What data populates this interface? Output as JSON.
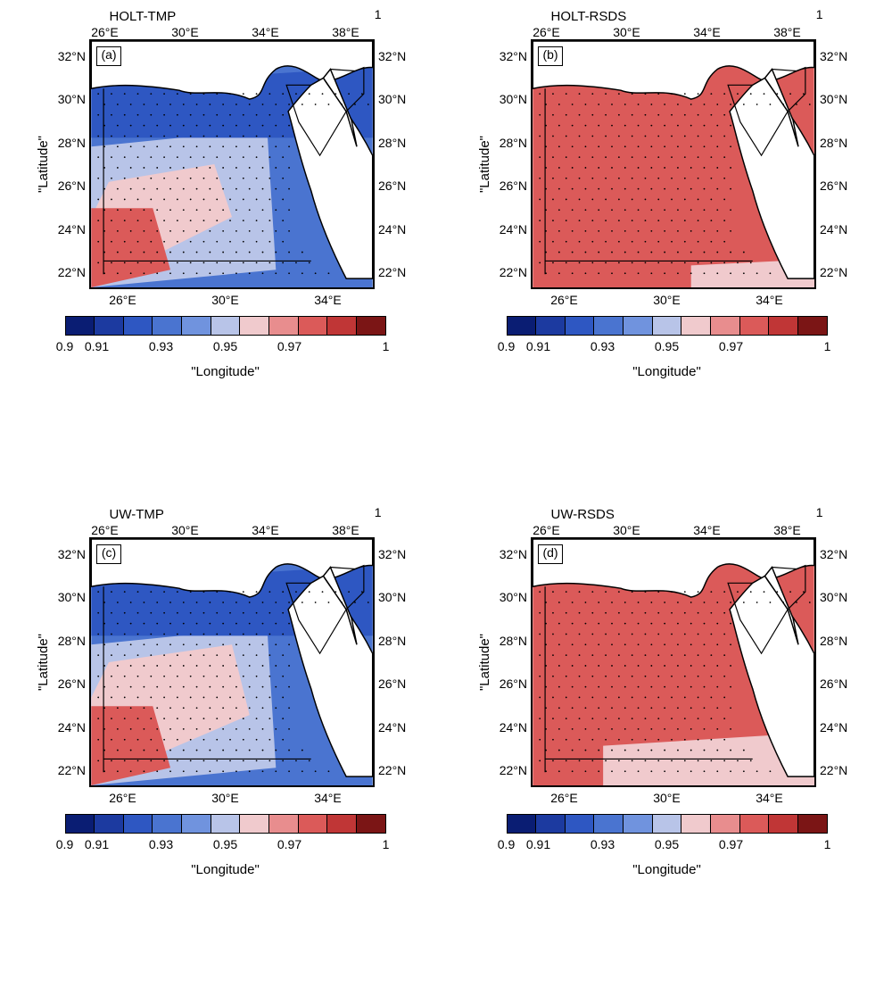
{
  "chart_data": [
    {
      "id": "a",
      "title": "HOLT-TMP",
      "panel_letter": "(a)",
      "type": "heatmap",
      "xlabel": "\"Longitude\"",
      "ylabel": "\"Latitude\"",
      "top_right": "1",
      "lon_ticks": [
        "26°E",
        "30°E",
        "34°E",
        "38°E"
      ],
      "lon_ticks_bottom": [
        "26°E",
        "30°E",
        "34°E"
      ],
      "lat_ticks": [
        "32°N",
        "30°N",
        "28°N",
        "26°N",
        "24°N",
        "22°N"
      ],
      "colorbar": {
        "levels": [
          0.9,
          0.91,
          0.92,
          0.93,
          0.94,
          0.95,
          0.96,
          0.97,
          0.98,
          0.99,
          1
        ],
        "colors": [
          "#0a1d73",
          "#1c3aa0",
          "#2e57c2",
          "#4a74d0",
          "#7093de",
          "#b8c4e8",
          "#f0cacd",
          "#e88d8e",
          "#db5a59",
          "#c03636",
          "#7b1515"
        ],
        "tick_labels": [
          "0.9",
          "0.91",
          "0.93",
          "0.95",
          "0.97",
          "1"
        ],
        "tick_pos": [
          0,
          0.1,
          0.3,
          0.5,
          0.7,
          1.0
        ]
      },
      "description": "Correlation map over Egypt/NE Africa. North coast band ~0.91–0.93 (blue). Central Nile/Sinai ~0.94 (light lavender). SW desert ~0.95–0.97 (pink/red). Far SW corner >0.97 (red). Stippling over most land."
    },
    {
      "id": "b",
      "title": "HOLT-RSDS",
      "panel_letter": "(b)",
      "type": "heatmap",
      "xlabel": "\"Longitude\"",
      "ylabel": "\"Latitude\"",
      "top_right": "1",
      "lon_ticks": [
        "26°E",
        "30°E",
        "34°E",
        "38°E"
      ],
      "lon_ticks_bottom": [
        "26°E",
        "30°E",
        "34°E"
      ],
      "lat_ticks": [
        "32°N",
        "30°N",
        "28°N",
        "26°N",
        "24°N",
        "22°N"
      ],
      "colorbar": {
        "levels": [
          0.9,
          0.91,
          0.92,
          0.93,
          0.94,
          0.95,
          0.96,
          0.97,
          0.98,
          0.99,
          1
        ],
        "colors": [
          "#0a1d73",
          "#1c3aa0",
          "#2e57c2",
          "#4a74d0",
          "#7093de",
          "#b8c4e8",
          "#f0cacd",
          "#e88d8e",
          "#db5a59",
          "#c03636",
          "#7b1515"
        ],
        "tick_labels": [
          "0.9",
          "0.91",
          "0.93",
          "0.95",
          "0.97",
          "1"
        ],
        "tick_pos": [
          0,
          0.1,
          0.3,
          0.5,
          0.7,
          1.0
        ]
      },
      "description": "Nearly uniform ~0.97–0.98 (red) over whole domain. Slight pink ~0.95–0.96 along far south strip. Stippled land."
    },
    {
      "id": "c",
      "title": "UW-TMP",
      "panel_letter": "(c)",
      "type": "heatmap",
      "xlabel": "\"Longitude\"",
      "ylabel": "\"Latitude\"",
      "top_right": "1",
      "lon_ticks": [
        "26°E",
        "30°E",
        "34°E",
        "38°E"
      ],
      "lon_ticks_bottom": [
        "26°E",
        "30°E",
        "34°E"
      ],
      "lat_ticks": [
        "32°N",
        "30°N",
        "28°N",
        "26°N",
        "24°N",
        "22°N"
      ],
      "colorbar": {
        "levels": [
          0.9,
          0.91,
          0.92,
          0.93,
          0.94,
          0.95,
          0.96,
          0.97,
          0.98,
          0.99,
          1
        ],
        "colors": [
          "#0a1d73",
          "#1c3aa0",
          "#2e57c2",
          "#4a74d0",
          "#7093de",
          "#b8c4e8",
          "#f0cacd",
          "#e88d8e",
          "#db5a59",
          "#c03636",
          "#7b1515"
        ],
        "tick_labels": [
          "0.9",
          "0.91",
          "0.93",
          "0.95",
          "0.97",
          "1"
        ],
        "tick_pos": [
          0,
          0.1,
          0.3,
          0.5,
          0.7,
          1.0
        ]
      },
      "description": "Similar to panel (a) but pink 0.95 region extends further north/east; SW red slightly larger."
    },
    {
      "id": "d",
      "title": "UW-RSDS",
      "panel_letter": "(d)",
      "type": "heatmap",
      "xlabel": "\"Longitude\"",
      "ylabel": "\"Latitude\"",
      "top_right": "1",
      "lon_ticks": [
        "26°E",
        "30°E",
        "34°E",
        "38°E"
      ],
      "lon_ticks_bottom": [
        "26°E",
        "30°E",
        "34°E"
      ],
      "lat_ticks": [
        "32°N",
        "30°N",
        "28°N",
        "26°N",
        "24°N",
        "22°N"
      ],
      "colorbar": {
        "levels": [
          0.9,
          0.91,
          0.92,
          0.93,
          0.94,
          0.95,
          0.96,
          0.97,
          0.98,
          0.99,
          1
        ],
        "colors": [
          "#0a1d73",
          "#1c3aa0",
          "#2e57c2",
          "#4a74d0",
          "#7093de",
          "#b8c4e8",
          "#f0cacd",
          "#e88d8e",
          "#db5a59",
          "#c03636",
          "#7b1515"
        ],
        "tick_labels": [
          "0.9",
          "0.91",
          "0.93",
          "0.95",
          "0.97",
          "1"
        ],
        "tick_pos": [
          0,
          0.1,
          0.3,
          0.5,
          0.7,
          1.0
        ]
      },
      "description": "Nearly uniform ~0.97 red. Southern strip pink ~0.95–0.96 wider than panel (b). Stippled."
    }
  ]
}
